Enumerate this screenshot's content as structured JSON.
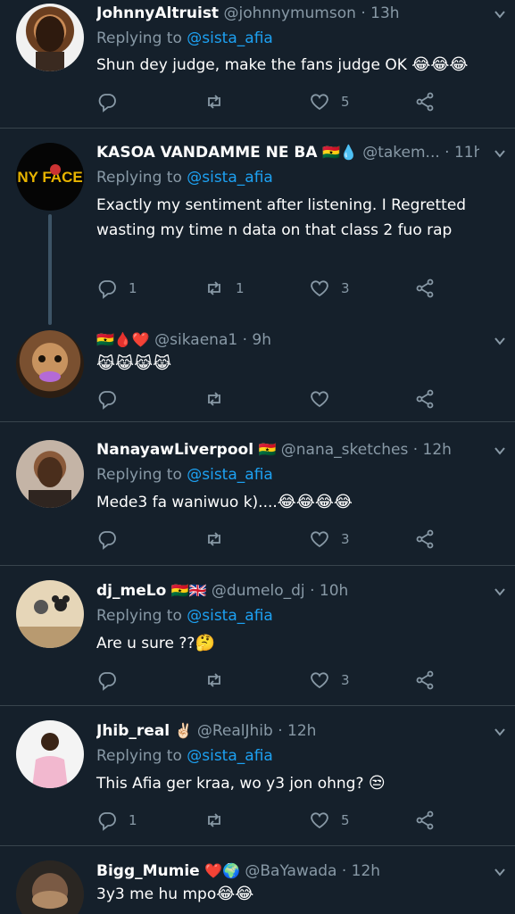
{
  "colors": {
    "background": "#15202b",
    "text": "#ffffff",
    "muted": "#8899a6",
    "mention": "#1da1f2",
    "divider": "#38444d"
  },
  "replying_label": "Replying to",
  "separator": "·",
  "tweets": [
    {
      "name": "JohnnyAltruist",
      "flags": "",
      "handle": "@johnnymumson",
      "time": "13h",
      "reply_to": "@sista_afia",
      "text": "Shun dey judge, make the fans judge OK",
      "emoji": "😂😂😂",
      "replies": "",
      "retweets": "",
      "likes": "5"
    },
    {
      "name": "KASOA VANDAMME NE BA",
      "flags": "🇬🇭💧",
      "handle": "@takem...",
      "time": "11h",
      "reply_to": "@sista_afia",
      "text": "Exactly my sentiment after listening. I Regretted  wasting my time n data on that class 2 fuo rap",
      "emoji": "",
      "replies": "1",
      "retweets": "1",
      "likes": "3"
    },
    {
      "name": "",
      "flags": "🇬🇭🩸❤️",
      "handle": "@sikaena1",
      "time": "9h",
      "reply_to": "",
      "text": "",
      "emoji": "😹😹😹😹",
      "replies": "",
      "retweets": "",
      "likes": ""
    },
    {
      "name": "NanayawLiverpool",
      "flags": "🇬🇭",
      "handle": "@nana_sketches",
      "time": "12h",
      "reply_to": "@sista_afia",
      "text": "Mede3 fa waniwuo k)....",
      "emoji": "😂😂😂😂",
      "replies": "",
      "retweets": "",
      "likes": "3"
    },
    {
      "name": "dj_meLo",
      "flags": "🇬🇭🇬🇧",
      "handle": "@dumelo_dj",
      "time": "10h",
      "reply_to": "@sista_afia",
      "text": "Are u sure ??",
      "emoji": "🤔",
      "replies": "",
      "retweets": "",
      "likes": "3"
    },
    {
      "name": "Jhib_real",
      "flags": "✌🏻",
      "handle": "@RealJhib",
      "time": "12h",
      "reply_to": "@sista_afia",
      "text": "This Afia ger kraa, wo y3 jon ohng?",
      "emoji": "😒",
      "replies": "1",
      "retweets": "",
      "likes": "5"
    },
    {
      "name": "Bigg_Mumie",
      "flags": "❤️🌍",
      "handle": "@BaYawada",
      "time": "12h",
      "reply_to": "",
      "text": "3y3 me hu mpo",
      "emoji": "😂😂",
      "replies": "",
      "retweets": "",
      "likes": ""
    }
  ]
}
